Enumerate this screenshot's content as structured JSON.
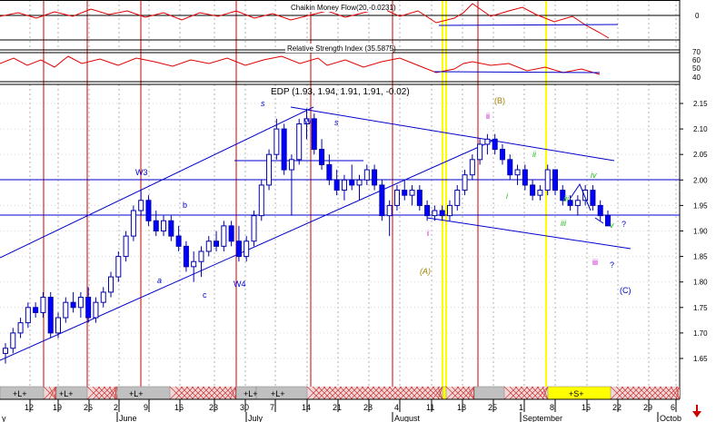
{
  "chart_data": [
    {
      "type": "line",
      "title": "Chaikin Money Flow(20,-0.0231)",
      "panel": "top",
      "ytick_labels": [
        "0"
      ]
    },
    {
      "type": "line",
      "title": "Relative Strength Index (35.5875)",
      "panel": "middle",
      "ytick_labels": [
        "70",
        "60",
        "50",
        "40"
      ]
    },
    {
      "type": "candlestick",
      "title": "EDP (1.93, 1.94, 1.91, 1.91, -0.02)",
      "panel": "main",
      "ylim": [
        1.6,
        2.2
      ],
      "yticks": [
        1.65,
        1.7,
        1.75,
        1.8,
        1.85,
        1.9,
        1.95,
        2.0,
        2.05,
        2.1,
        2.15
      ],
      "ytick_labels": [
        "1.65",
        "1.70",
        "1.75",
        "1.80",
        "1.85",
        "1.90",
        "1.95",
        "2.00",
        "2.05",
        "2.10",
        "2.15"
      ],
      "candles": [
        {
          "o": 1.66,
          "h": 1.68,
          "l": 1.64,
          "c": 1.67
        },
        {
          "o": 1.67,
          "h": 1.71,
          "l": 1.66,
          "c": 1.7
        },
        {
          "o": 1.7,
          "h": 1.73,
          "l": 1.69,
          "c": 1.72
        },
        {
          "o": 1.72,
          "h": 1.76,
          "l": 1.71,
          "c": 1.75
        },
        {
          "o": 1.75,
          "h": 1.76,
          "l": 1.73,
          "c": 1.74
        },
        {
          "o": 1.74,
          "h": 1.78,
          "l": 1.73,
          "c": 1.77
        },
        {
          "o": 1.77,
          "h": 1.78,
          "l": 1.69,
          "c": 1.7
        },
        {
          "o": 1.7,
          "h": 1.74,
          "l": 1.69,
          "c": 1.73
        },
        {
          "o": 1.73,
          "h": 1.77,
          "l": 1.72,
          "c": 1.76
        },
        {
          "o": 1.76,
          "h": 1.78,
          "l": 1.74,
          "c": 1.75
        },
        {
          "o": 1.75,
          "h": 1.78,
          "l": 1.73,
          "c": 1.77
        },
        {
          "o": 1.77,
          "h": 1.79,
          "l": 1.72,
          "c": 1.73
        },
        {
          "o": 1.73,
          "h": 1.77,
          "l": 1.72,
          "c": 1.76
        },
        {
          "o": 1.76,
          "h": 1.79,
          "l": 1.75,
          "c": 1.78
        },
        {
          "o": 1.78,
          "h": 1.82,
          "l": 1.77,
          "c": 1.81
        },
        {
          "o": 1.81,
          "h": 1.86,
          "l": 1.8,
          "c": 1.85
        },
        {
          "o": 1.85,
          "h": 1.9,
          "l": 1.84,
          "c": 1.89
        },
        {
          "o": 1.89,
          "h": 1.95,
          "l": 1.88,
          "c": 1.94
        },
        {
          "o": 1.94,
          "h": 1.98,
          "l": 1.93,
          "c": 1.96
        },
        {
          "o": 1.96,
          "h": 1.97,
          "l": 1.91,
          "c": 1.92
        },
        {
          "o": 1.92,
          "h": 1.94,
          "l": 1.89,
          "c": 1.9
        },
        {
          "o": 1.9,
          "h": 1.93,
          "l": 1.89,
          "c": 1.92
        },
        {
          "o": 1.92,
          "h": 1.93,
          "l": 1.88,
          "c": 1.89
        },
        {
          "o": 1.89,
          "h": 1.91,
          "l": 1.86,
          "c": 1.87
        },
        {
          "o": 1.87,
          "h": 1.88,
          "l": 1.82,
          "c": 1.83
        },
        {
          "o": 1.83,
          "h": 1.86,
          "l": 1.8,
          "c": 1.84
        },
        {
          "o": 1.84,
          "h": 1.87,
          "l": 1.81,
          "c": 1.86
        },
        {
          "o": 1.86,
          "h": 1.89,
          "l": 1.85,
          "c": 1.88
        },
        {
          "o": 1.88,
          "h": 1.9,
          "l": 1.86,
          "c": 1.87
        },
        {
          "o": 1.87,
          "h": 1.92,
          "l": 1.86,
          "c": 1.91
        },
        {
          "o": 1.91,
          "h": 1.92,
          "l": 1.87,
          "c": 1.88
        },
        {
          "o": 1.88,
          "h": 1.91,
          "l": 1.84,
          "c": 1.85
        },
        {
          "o": 1.85,
          "h": 1.89,
          "l": 1.84,
          "c": 1.88
        },
        {
          "o": 1.88,
          "h": 1.94,
          "l": 1.87,
          "c": 1.93
        },
        {
          "o": 1.93,
          "h": 2.0,
          "l": 1.92,
          "c": 1.99
        },
        {
          "o": 1.99,
          "h": 2.06,
          "l": 1.98,
          "c": 2.05
        },
        {
          "o": 2.05,
          "h": 2.12,
          "l": 2.04,
          "c": 2.1
        },
        {
          "o": 2.1,
          "h": 2.11,
          "l": 2.01,
          "c": 2.02
        },
        {
          "o": 2.02,
          "h": 2.05,
          "l": 1.93,
          "c": 2.04
        },
        {
          "o": 2.04,
          "h": 2.12,
          "l": 2.03,
          "c": 2.11
        },
        {
          "o": 2.11,
          "h": 2.14,
          "l": 2.08,
          "c": 2.12
        },
        {
          "o": 2.12,
          "h": 2.13,
          "l": 2.05,
          "c": 2.06
        },
        {
          "o": 2.06,
          "h": 2.08,
          "l": 2.02,
          "c": 2.03
        },
        {
          "o": 2.03,
          "h": 2.05,
          "l": 1.99,
          "c": 2.0
        },
        {
          "o": 2.0,
          "h": 2.02,
          "l": 1.97,
          "c": 1.98
        },
        {
          "o": 1.98,
          "h": 2.01,
          "l": 1.96,
          "c": 2.0
        },
        {
          "o": 2.0,
          "h": 2.03,
          "l": 1.98,
          "c": 1.99
        },
        {
          "o": 1.99,
          "h": 2.01,
          "l": 1.96,
          "c": 2.0
        },
        {
          "o": 2.0,
          "h": 2.03,
          "l": 1.99,
          "c": 2.02
        },
        {
          "o": 2.02,
          "h": 2.03,
          "l": 1.98,
          "c": 1.99
        },
        {
          "o": 1.99,
          "h": 2.0,
          "l": 1.92,
          "c": 1.93
        },
        {
          "o": 1.93,
          "h": 1.96,
          "l": 1.89,
          "c": 1.95
        },
        {
          "o": 1.95,
          "h": 1.99,
          "l": 1.94,
          "c": 1.98
        },
        {
          "o": 1.98,
          "h": 2.0,
          "l": 1.96,
          "c": 1.97
        },
        {
          "o": 1.97,
          "h": 1.99,
          "l": 1.95,
          "c": 1.98
        },
        {
          "o": 1.98,
          "h": 1.99,
          "l": 1.94,
          "c": 1.95
        },
        {
          "o": 1.95,
          "h": 1.96,
          "l": 1.92,
          "c": 1.93
        },
        {
          "o": 1.93,
          "h": 1.95,
          "l": 1.92,
          "c": 1.94
        },
        {
          "o": 1.94,
          "h": 1.95,
          "l": 1.92,
          "c": 1.93
        },
        {
          "o": 1.93,
          "h": 1.96,
          "l": 1.92,
          "c": 1.95
        },
        {
          "o": 1.95,
          "h": 1.99,
          "l": 1.94,
          "c": 1.98
        },
        {
          "o": 1.98,
          "h": 2.02,
          "l": 1.97,
          "c": 2.01
        },
        {
          "o": 2.01,
          "h": 2.05,
          "l": 2.0,
          "c": 2.04
        },
        {
          "o": 2.04,
          "h": 2.08,
          "l": 2.03,
          "c": 2.07
        },
        {
          "o": 2.07,
          "h": 2.09,
          "l": 2.05,
          "c": 2.08
        },
        {
          "o": 2.08,
          "h": 2.09,
          "l": 2.05,
          "c": 2.06
        },
        {
          "o": 2.06,
          "h": 2.07,
          "l": 2.03,
          "c": 2.04
        },
        {
          "o": 2.04,
          "h": 2.05,
          "l": 2.0,
          "c": 2.01
        },
        {
          "o": 2.01,
          "h": 2.03,
          "l": 1.99,
          "c": 2.02
        },
        {
          "o": 2.02,
          "h": 2.03,
          "l": 1.98,
          "c": 1.99
        },
        {
          "o": 1.99,
          "h": 2.0,
          "l": 1.96,
          "c": 1.97
        },
        {
          "o": 1.97,
          "h": 1.99,
          "l": 1.96,
          "c": 1.98
        },
        {
          "o": 1.98,
          "h": 2.03,
          "l": 1.97,
          "c": 2.02
        },
        {
          "o": 2.02,
          "h": 2.02,
          "l": 1.97,
          "c": 1.98
        },
        {
          "o": 1.98,
          "h": 1.99,
          "l": 1.95,
          "c": 1.96
        },
        {
          "o": 1.96,
          "h": 1.97,
          "l": 1.94,
          "c": 1.95
        },
        {
          "o": 1.95,
          "h": 1.97,
          "l": 1.93,
          "c": 1.96
        },
        {
          "o": 1.96,
          "h": 1.99,
          "l": 1.95,
          "c": 1.98
        },
        {
          "o": 1.98,
          "h": 1.99,
          "l": 1.94,
          "c": 1.95
        },
        {
          "o": 1.95,
          "h": 1.96,
          "l": 1.92,
          "c": 1.93
        },
        {
          "o": 1.93,
          "h": 1.94,
          "l": 1.91,
          "c": 1.91
        }
      ],
      "annotations": [
        "W3",
        "b",
        "a",
        "c",
        "W4",
        "s",
        "s",
        "W5",
        "(B)",
        "ii",
        "ii",
        "i",
        "i",
        "(A)",
        "iii",
        "iv",
        "iii",
        "v",
        "?",
        "iii",
        "?",
        "(C)"
      ],
      "colors": {
        "up": "#ffffff",
        "down": "#0000ff",
        "trend": "#0000cc",
        "cycle": "#cc0000",
        "highlight": "#ffff00",
        "grid": "#b0b0b0"
      }
    }
  ],
  "x_axis": {
    "day_labels": [
      "12",
      "19",
      "26",
      "2",
      "9",
      "16",
      "23",
      "30",
      "7",
      "14",
      "21",
      "28",
      "4",
      "11",
      "18",
      "25",
      "1",
      "8",
      "15",
      "22",
      "29",
      "6"
    ],
    "month_labels": [
      "y",
      "June",
      "July",
      "August",
      "September",
      "Octob"
    ]
  },
  "signal_bar": {
    "labels": [
      "+L+",
      "+L+",
      "+L+",
      "+L+",
      "+L+",
      "+S+"
    ]
  }
}
